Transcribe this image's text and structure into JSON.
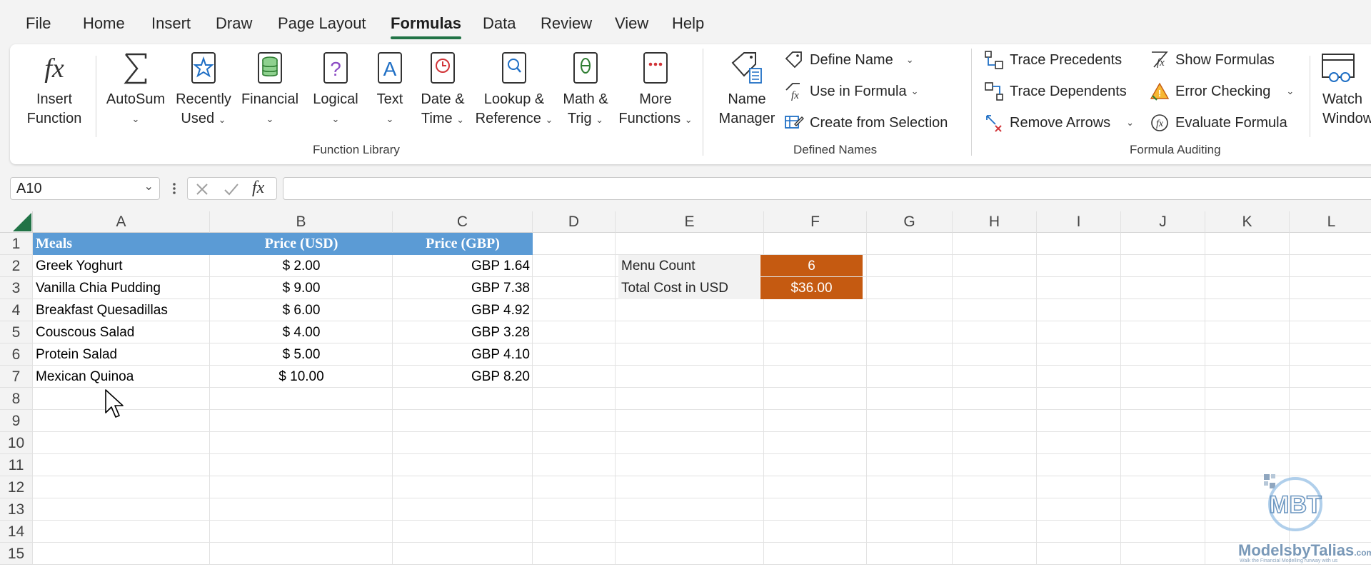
{
  "menu": {
    "tabs": [
      {
        "label": "File"
      },
      {
        "label": "Home"
      },
      {
        "label": "Insert"
      },
      {
        "label": "Draw"
      },
      {
        "label": "Page Layout"
      },
      {
        "label": "Formulas"
      },
      {
        "label": "Data"
      },
      {
        "label": "Review"
      },
      {
        "label": "View"
      },
      {
        "label": "Help"
      }
    ],
    "active": "Formulas"
  },
  "ribbon": {
    "insert_function": {
      "line1": "Insert",
      "line2": "Function",
      "icon": "fx-icon"
    },
    "function_library": {
      "group_label": "Function Library",
      "buttons": [
        {
          "line1": "AutoSum",
          "line2": "",
          "icon": "sigma-icon"
        },
        {
          "line1": "Recently",
          "line2": "Used",
          "icon": "star-book-icon"
        },
        {
          "line1": "Financial",
          "line2": "",
          "icon": "coins-book-icon"
        },
        {
          "line1": "Logical",
          "line2": "",
          "icon": "question-book-icon"
        },
        {
          "line1": "Text",
          "line2": "",
          "icon": "text-book-icon"
        },
        {
          "line1": "Date &",
          "line2": "Time",
          "icon": "clock-book-icon"
        },
        {
          "line1": "Lookup &",
          "line2": "Reference",
          "icon": "magnifier-book-icon"
        },
        {
          "line1": "Math &",
          "line2": "Trig",
          "icon": "theta-book-icon"
        },
        {
          "line1": "More",
          "line2": "Functions",
          "icon": "dots-book-icon"
        }
      ]
    },
    "defined_names": {
      "group_label": "Defined Names",
      "name_manager": {
        "line1": "Name",
        "line2": "Manager"
      },
      "define_name": "Define Name",
      "use_in_formula": "Use in Formula",
      "create_from_selection": "Create from Selection"
    },
    "formula_auditing": {
      "group_label": "Formula Auditing",
      "trace_precedents": "Trace Precedents",
      "trace_dependents": "Trace Dependents",
      "remove_arrows": "Remove Arrows",
      "show_formulas": "Show Formulas",
      "error_checking": "Error Checking",
      "evaluate_formula": "Evaluate Formula",
      "watch_window": {
        "line1": "Watch",
        "line2": "Window"
      }
    }
  },
  "formula_bar": {
    "name_box": "A10",
    "fx_label": "fx",
    "formula": ""
  },
  "grid": {
    "columns": [
      "A",
      "B",
      "C",
      "D",
      "E",
      "F",
      "G",
      "H",
      "I",
      "J",
      "K",
      "L"
    ],
    "rows": [
      "1",
      "2",
      "3",
      "4",
      "5",
      "6",
      "7",
      "8",
      "9",
      "10",
      "11",
      "12",
      "13",
      "14",
      "15"
    ],
    "table": {
      "headers": [
        "Meals",
        "Price (USD)",
        "Price (GBP)"
      ],
      "rows": [
        [
          "Greek Yoghurt",
          "$ 2.00",
          "GBP 1.64"
        ],
        [
          "Vanilla Chia Pudding",
          "$ 9.00",
          "GBP 7.38"
        ],
        [
          "Breakfast Quesadillas",
          "$ 6.00",
          "GBP 4.92"
        ],
        [
          "Couscous Salad",
          "$ 4.00",
          "GBP 3.28"
        ],
        [
          "Protein Salad",
          "$ 5.00",
          "GBP 4.10"
        ],
        [
          "Mexican Quinoa",
          "$ 10.00",
          "GBP 8.20"
        ]
      ]
    },
    "summary": {
      "menu_count_label": "Menu Count",
      "menu_count_value": "6",
      "total_cost_label": "Total Cost in USD",
      "total_cost_value": "$36.00"
    }
  },
  "watermark": {
    "logo_text": "MBT",
    "brand": "ModelsbyTalias",
    "domain": ".com",
    "tagline": "Walk the Financial Modelling runway with us"
  },
  "colors": {
    "accent_green": "#217346",
    "table_header_blue": "#5b9bd5",
    "summary_orange": "#c55a11",
    "icon_blue": "#1f6fc5"
  }
}
